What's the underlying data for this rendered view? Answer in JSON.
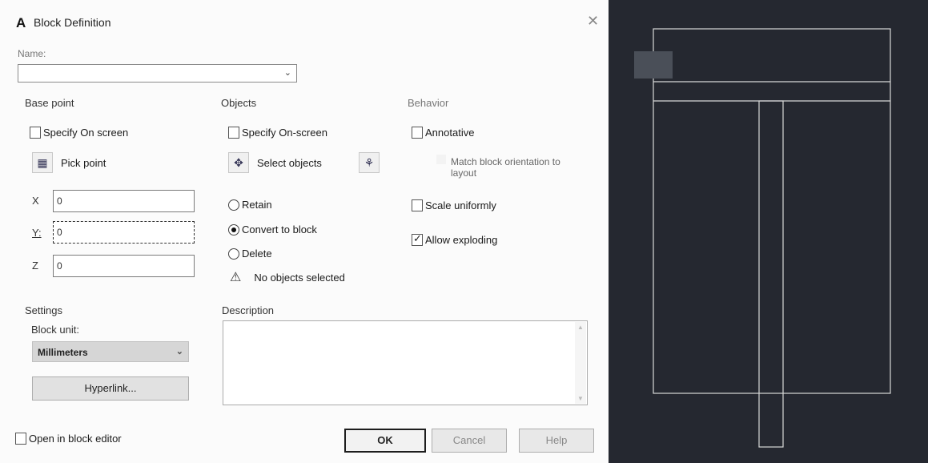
{
  "dialog": {
    "title": "Block Definition",
    "app_icon": "autocad-a-icon",
    "close_glyph": "✕"
  },
  "name": {
    "label": "Name:",
    "value": ""
  },
  "base_point": {
    "heading": "Base point",
    "specify_onscreen": "Specify On screen",
    "specify_checked": false,
    "pick_point": "Pick point",
    "x_label": "X",
    "x_value": "0",
    "y_label": "Y:",
    "y_value": "0",
    "z_label": "Z",
    "z_value": "0"
  },
  "objects": {
    "heading": "Objects",
    "specify_onscreen": "Specify On-screen",
    "specify_checked": false,
    "select_objects": "Select objects",
    "retain": "Retain",
    "convert": "Convert to block",
    "delete": "Delete",
    "selected_option": "convert",
    "status": "No objects selected"
  },
  "behavior": {
    "heading": "Behavior",
    "annotative": "Annotative",
    "annotative_checked": false,
    "match_orientation": "Match block orientation to layout",
    "scale_uniformly": "Scale uniformly",
    "scale_checked": false,
    "allow_exploding": "Allow exploding",
    "exploding_checked": true
  },
  "settings": {
    "heading": "Settings",
    "block_unit_label": "Block unit:",
    "block_unit_value": "Millimeters",
    "hyperlink": "Hyperlink..."
  },
  "description": {
    "label": "Description",
    "value": ""
  },
  "footer": {
    "open_in_editor": "Open in block editor",
    "open_checked": false,
    "ok": "OK",
    "cancel": "Cancel",
    "help": "Help"
  },
  "colors": {
    "cad_background": "#252830",
    "cad_lines": "#d8d8d8",
    "dialog_background": "#fbfbfb"
  }
}
